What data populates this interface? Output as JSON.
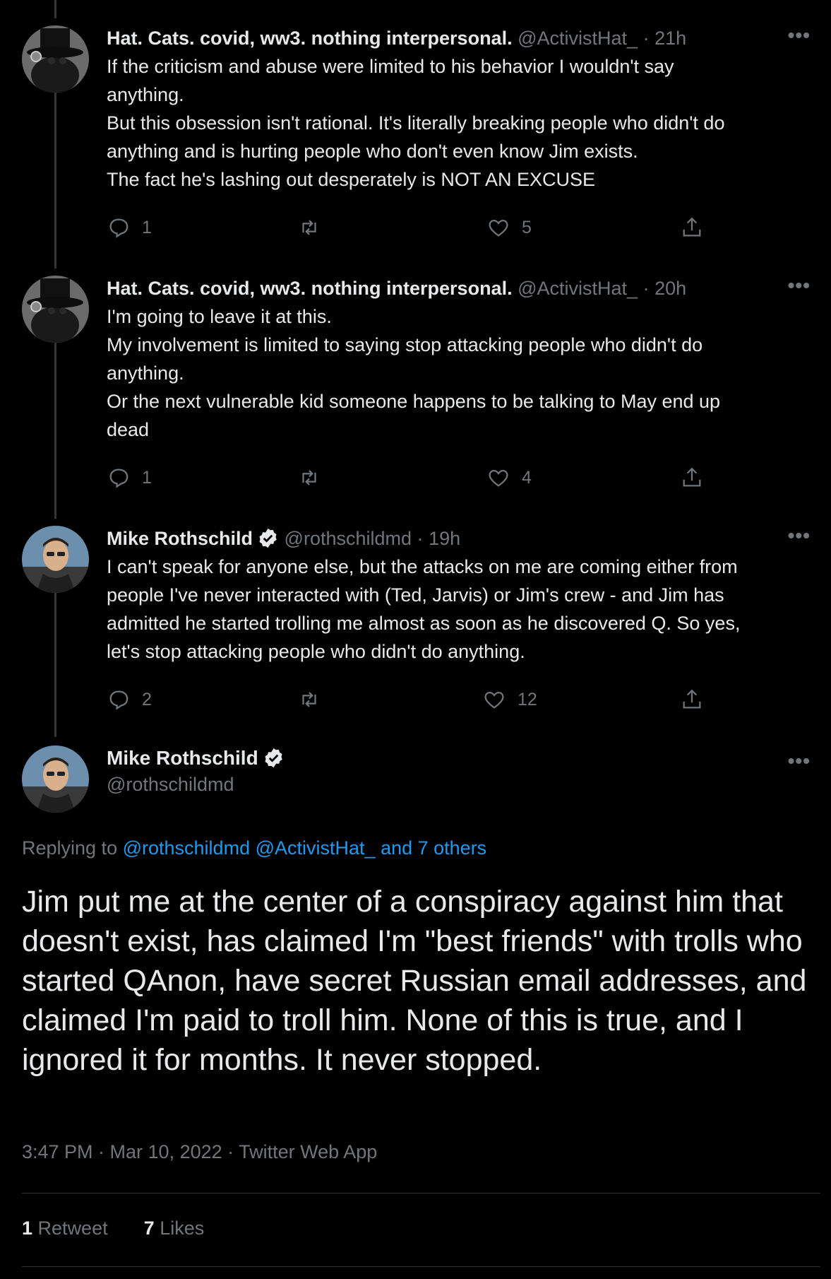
{
  "tweets": [
    {
      "name": "Hat. Cats. covid, ww3. nothing interpersonal.",
      "handle": "@ActivistHat_",
      "dot": "·",
      "time": "21h",
      "text": "If the criticism and abuse were limited to his behavior I wouldn't say\nanything.\nBut this obsession isn't rational. It's literally breaking people who didn't do\nanything and is hurting people who don't even know Jim exists.\nThe fact he's lashing out desperately is NOT AN EXCUSE",
      "replies": "1",
      "retweets": "",
      "likes": "5"
    },
    {
      "name": "Hat. Cats. covid, ww3. nothing interpersonal.",
      "handle": "@ActivistHat_",
      "dot": "·",
      "time": "20h",
      "text": "I'm going to leave it at this.\nMy involvement is limited to saying stop attacking people who didn't do\nanything.\nOr the next vulnerable kid someone happens to be talking to May end up\ndead",
      "replies": "1",
      "retweets": "",
      "likes": "4"
    },
    {
      "name": "Mike Rothschild",
      "handle": "@rothschildmd",
      "dot": "·",
      "time": "19h",
      "text": "I can't speak for anyone else, but the attacks on me are coming either from\npeople I've never interacted with (Ted, Jarvis) or Jim's crew - and Jim has\nadmitted he started trolling me almost as soon as he discovered Q. So yes,\nlet's stop attacking people who didn't do anything.",
      "replies": "2",
      "retweets": "",
      "likes": "12"
    }
  ],
  "main": {
    "name": "Mike Rothschild",
    "handle": "@rothschildmd",
    "replying_prefix": "Replying to",
    "replying_links": [
      "@rothschildmd",
      "@ActivistHat_",
      "and 7 others"
    ],
    "text": "Jim put me at the center of a conspiracy against him that doesn't exist, has claimed I'm \"best friends\" with trolls who started QAnon, have secret Russian email addresses, and claimed I'm paid to troll him. None of this is true, and I ignored it for months. It never stopped.",
    "meta": "3:47 PM · Mar 10, 2022 · Twitter Web App",
    "retweet_count": "1",
    "retweet_label": "Retweet",
    "like_count": "7",
    "like_label": "Likes"
  },
  "more_label": "•••",
  "colors": {
    "background": "#000000",
    "text": "#e7e9ea",
    "muted": "#71767b",
    "link": "#1d9bf0",
    "verified": "#e7e9ea"
  },
  "icons": [
    "reply-icon",
    "retweet-icon",
    "like-icon",
    "share-icon",
    "verified-icon",
    "more-icon"
  ]
}
